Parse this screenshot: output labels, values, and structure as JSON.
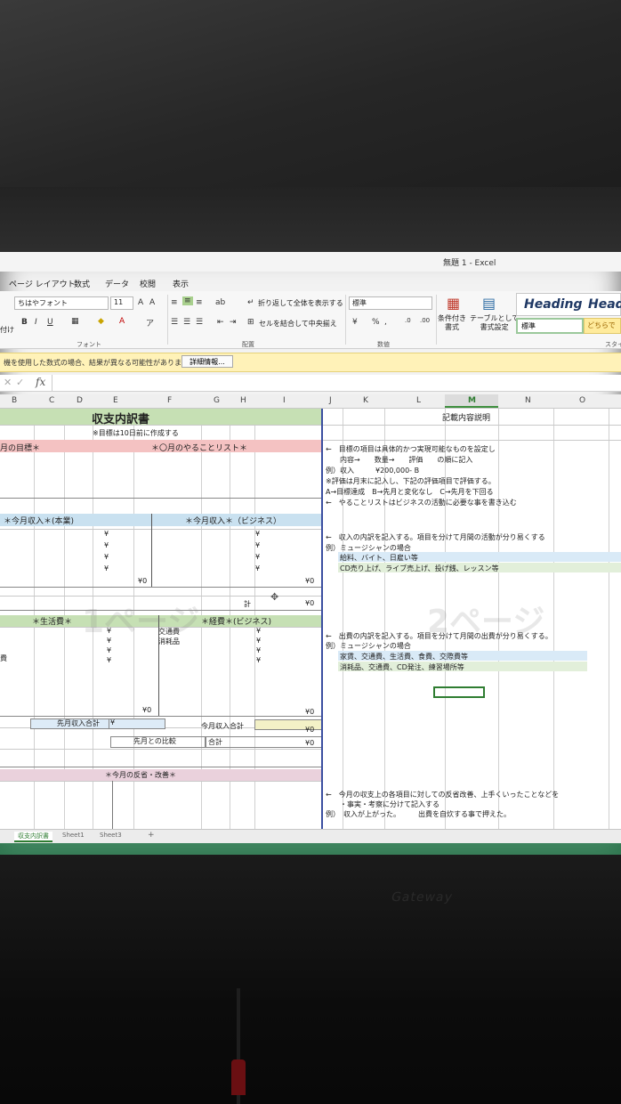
{
  "window": {
    "title": "無題 1 - Excel"
  },
  "menu": [
    "ページ レイアウト",
    "数式",
    "データ",
    "校閲",
    "表示"
  ],
  "ribbon": {
    "font_name": "ちはやフォント",
    "font_size": "11",
    "wrap_text": "折り返して全体を表示する",
    "merge_center": "セルを結合して中央揃え",
    "number_format": "標準",
    "conditional_format": "条件付き\n書式",
    "format_as_table": "テーブルとして\n書式設定",
    "groups": {
      "font": "フォント",
      "alignment": "配置",
      "number": "数値",
      "styles": "スタイ"
    },
    "styles": {
      "heading": "Heading",
      "heading2": "Head",
      "normal": "標準",
      "which": "どちらで"
    },
    "paste_label": "付け"
  },
  "notice": {
    "text": "機を使用した数式の場合、結果が異なる可能性があります。",
    "button": "詳細情報..."
  },
  "formula_bar": {
    "fx": "fx"
  },
  "columns": [
    "B",
    "C",
    "D",
    "E",
    "F",
    "G",
    "H",
    "I",
    "J",
    "K",
    "L",
    "M",
    "N",
    "O"
  ],
  "sheet": {
    "title": "収支内訳書",
    "note_goal": "※目標は10日前に作成する",
    "goal_header": "月の目標＊",
    "todo_header": "＊〇月のやることリスト＊",
    "income_main": "＊今月収入＊(本業)",
    "income_biz": "＊今月収入＊（ビジネス）",
    "yen": "¥",
    "zero": "¥0",
    "total": "計",
    "living_cost": "＊生活費＊",
    "biz_cost": "＊経費＊(ビジネス)",
    "transport": "交通費",
    "consumables": "消耗品",
    "cost_label": "費",
    "prev_income_total": "先月収入合計",
    "this_income_total": "今月収入合計",
    "compare_prev": "先月との比較",
    "sum": "合計",
    "reflection": "＊今月の反省・改善＊",
    "watermark_1": "1ページ",
    "watermark_2": "2ページ"
  },
  "description": {
    "title": "記載内容説明",
    "goal": [
      "←　目標の項目は具体的かつ実現可能なものを設定し",
      "内容→　　数量→　　評価　　の順に記入",
      "例）収入　　　¥200,000-  B",
      "※評価は月末に記入し、下記の評価項目で評価する。",
      "A→目標達成　B→先月と変化なし　C→先月を下回る",
      "←　やることリストはビジネスの活動に必要な事を書き込む"
    ],
    "income": [
      "←　収入の内訳を記入する。項目を分けて月間の活動が分り易くする",
      "例）ミュージシャンの場合",
      "給料、バイト、日雇い等",
      "CD売り上げ、ライブ売上げ、投げ銭、レッスン等"
    ],
    "expense": [
      "←　出費の内訳を記入する。項目を分けて月間の出費が分り易くする。",
      "例）ミュージシャンの場合",
      "家賃、交通費、生活費、食費、交際費等",
      "消耗品、交通費、CD発注、練習場所等"
    ],
    "reflection": [
      "←　今月の収支上の各項目に対しての反省改善、上手くいったことなどを",
      "・事実・考察に分けて記入する",
      "例）　収入が上がった。　　　出費を自炊する事で押えた。"
    ]
  },
  "sheet_tabs": [
    "収支内訳書",
    "Sheet1",
    "Sheet3",
    "+"
  ],
  "monitor": {
    "brand": "Gateway"
  }
}
